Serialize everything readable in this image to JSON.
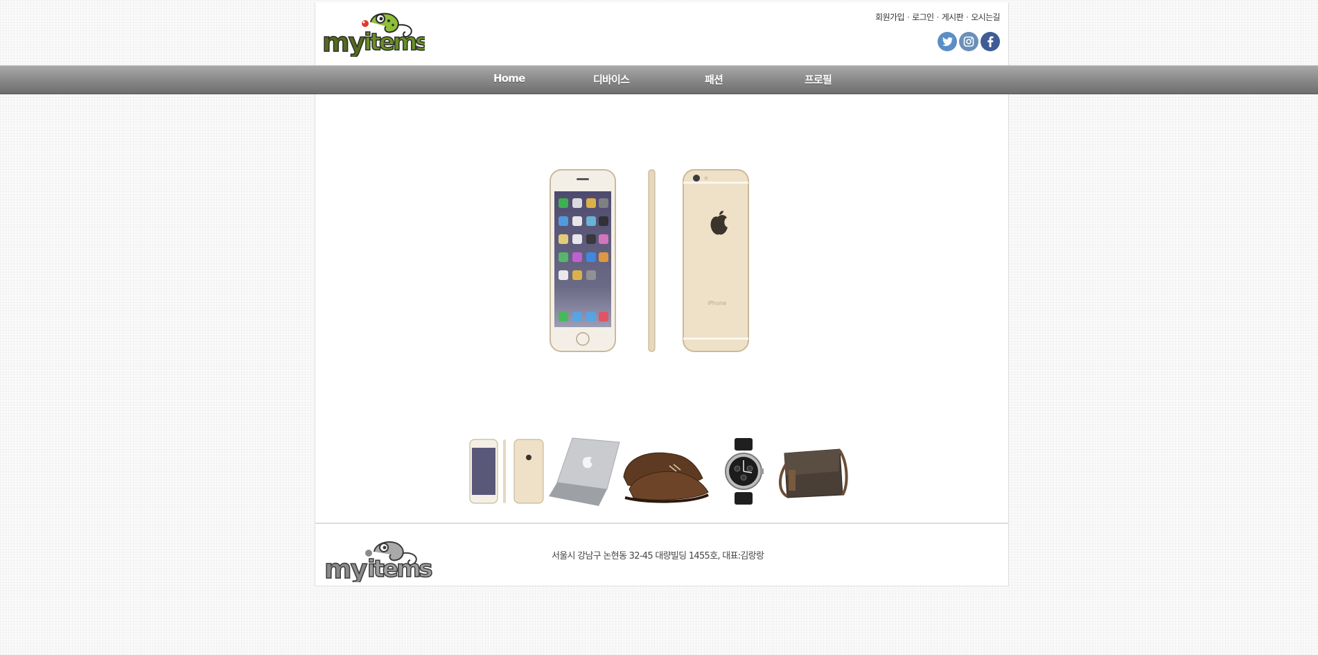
{
  "header": {
    "logo_text": "my items",
    "top_links": [
      "회원가입",
      "로그인",
      "게시판",
      "오시는길"
    ],
    "social": [
      {
        "name": "twitter",
        "icon": "twitter-icon",
        "color": "#5b8ec6"
      },
      {
        "name": "instagram",
        "icon": "instagram-icon",
        "color": "#6b8fb8"
      },
      {
        "name": "facebook",
        "icon": "facebook-icon",
        "color": "#3f5c94"
      }
    ]
  },
  "nav": {
    "items": [
      "Home",
      "디바이스",
      "패션",
      "프로필"
    ]
  },
  "main": {
    "hero_image": "iphone-6-gold-front-side-back",
    "thumbnails": [
      {
        "name": "iphone-thumbnail"
      },
      {
        "name": "macbook-thumbnail"
      },
      {
        "name": "shoes-thumbnail"
      },
      {
        "name": "watch-thumbnail"
      },
      {
        "name": "bag-thumbnail"
      }
    ]
  },
  "footer": {
    "logo_text": "my items",
    "address": "서울시 강남구 논현동 32-45 대량빌딩 1455호, 대표:김랑랑"
  }
}
